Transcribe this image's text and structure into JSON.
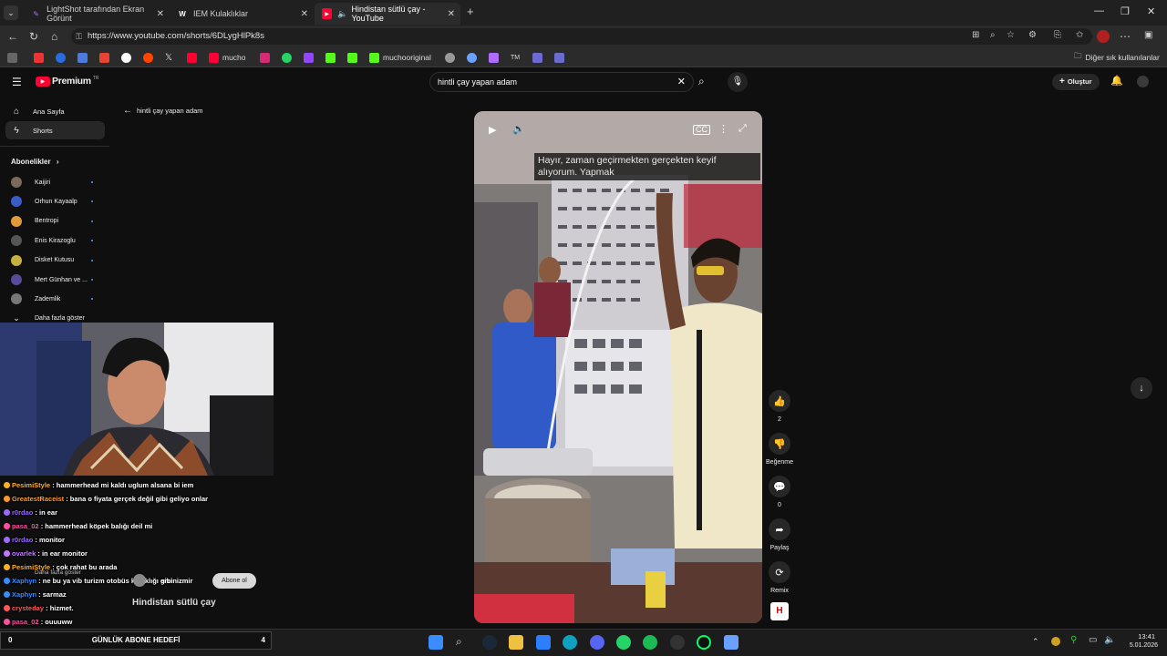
{
  "browser": {
    "tabs": [
      {
        "label": "LightShot tarafından Ekran Görünt",
        "active": false
      },
      {
        "label": "IEM Kulaklıklar",
        "active": false
      },
      {
        "label": "Hindistan sütlü çay - YouTube",
        "active": true
      }
    ],
    "url": "https://www.youtube.com/shorts/6DLygHlPk8s",
    "bookmarks": [
      "mucho",
      "muchooriginal"
    ],
    "bookmarks_other": "Diğer sık kullanılanlar"
  },
  "youtube": {
    "logo": "Premium",
    "logo_region": "TR",
    "search_value": "hintli çay yapan adam",
    "create_label": "Oluştur",
    "sidebar": {
      "items": [
        {
          "label": "Ana Sayfa",
          "icon": "home-icon"
        },
        {
          "label": "Shorts",
          "icon": "shorts-icon"
        }
      ],
      "subscriptions_title": "Abonelikler",
      "subscriptions": [
        {
          "name": "Kaijiri",
          "color": "#7a6a5a"
        },
        {
          "name": "Orhun Kayaalp",
          "color": "#3a5bc8"
        },
        {
          "name": "Bentropi",
          "color": "#e09a3a"
        },
        {
          "name": "Enis Kirazoglu",
          "color": "#555555"
        },
        {
          "name": "Disket Kutusu",
          "color": "#c8b040"
        },
        {
          "name": "Mert Günhan ve ...",
          "color": "#5a4a9a"
        },
        {
          "name": "Zademlik",
          "color": "#777777"
        }
      ],
      "show_more": "Daha fazla göster"
    },
    "shorts_back_label": "hintli çay yapan adam",
    "caption": "Hayır, zaman geçirmekten gerçekten keyif alıyorum. Yapmak",
    "actions": {
      "like_count": "2",
      "dislike_label": "Beğenme",
      "comment_count": "0",
      "share_label": "Paylaş",
      "remix_label": "Remix"
    },
    "video_title": "Hindistan sütlü çay",
    "subscribe_label": "Abone ol",
    "channel_label": "ercinizmir"
  },
  "overlay": {
    "chat": [
      {
        "user": "PesimiStyle",
        "color": "#ffb020",
        "msg": "hammerhead mi kaldı uglum alsana bi iem"
      },
      {
        "user": "GreatestRaceist",
        "color": "#ff9a2a",
        "msg": "bana o fiyata gerçek değil gibi geliyo onlar"
      },
      {
        "user": "r0rdao",
        "color": "#9b6bff",
        "msg": "in ear"
      },
      {
        "user": "pasa_02",
        "color": "#ff4fa0",
        "msg": "hammerhead köpek balığı deil mi"
      },
      {
        "user": "r0rdao",
        "color": "#9b6bff",
        "msg": "monitor"
      },
      {
        "user": "ovarlek",
        "color": "#c07aff",
        "msg": "in ear monitor"
      },
      {
        "user": "PesimiStyle",
        "color": "#ffb020",
        "msg": "çok rahat bu arada"
      },
      {
        "user": "Xaphyn",
        "color": "#3a8cff",
        "msg": "ne bu ya vib turizm otobüs kulaklığı gibi"
      },
      {
        "user": "Xaphyn",
        "color": "#3a8cff",
        "msg": "sarmaz"
      },
      {
        "user": "crysteday",
        "color": "#ff5a5a",
        "msg": "hizmet."
      },
      {
        "user": "pasa_02",
        "color": "#ff4fa0",
        "msg": "ouuuww"
      }
    ],
    "goal_left": "0",
    "goal_label": "GÜNLÜK ABONE HEDEFİ",
    "goal_right": "4"
  },
  "taskbar": {
    "time": "13:41",
    "date": "5.01.2026"
  }
}
